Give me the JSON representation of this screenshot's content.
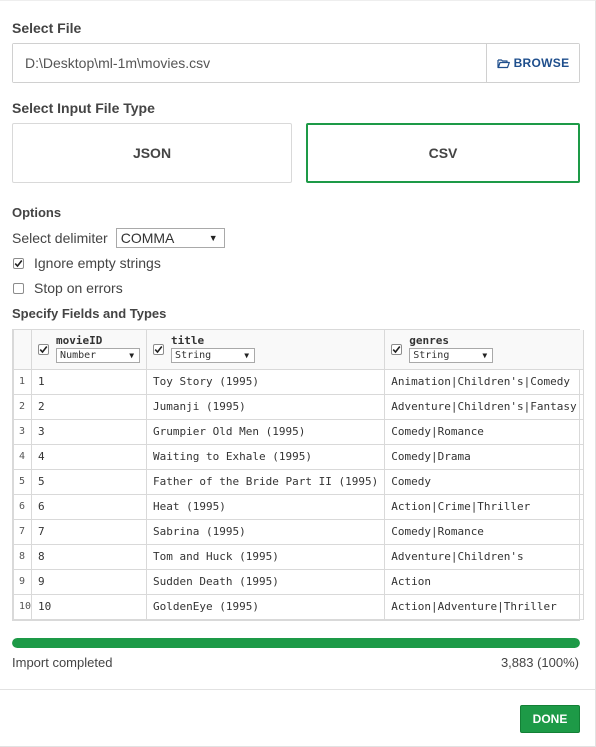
{
  "select_file": {
    "title": "Select File",
    "path": "D:\\Desktop\\ml-1m\\movies.csv",
    "browse_label": "BROWSE"
  },
  "input_type": {
    "title": "Select Input File Type",
    "json_label": "JSON",
    "csv_label": "CSV",
    "selected": "CSV"
  },
  "options": {
    "title": "Options",
    "delimiter_label": "Select delimiter",
    "delimiter_value": "COMMA",
    "ignore_empty_label": "Ignore empty strings",
    "ignore_empty_checked": true,
    "stop_on_errors_label": "Stop on errors",
    "stop_on_errors_checked": false
  },
  "fields": {
    "title": "Specify Fields and Types",
    "columns": [
      {
        "name": "movieID",
        "type": "Number",
        "checked": true
      },
      {
        "name": "title",
        "type": "String",
        "checked": true
      },
      {
        "name": "genres",
        "type": "String",
        "checked": true
      }
    ],
    "rows": [
      {
        "n": "1",
        "cells": [
          "1",
          "Toy Story (1995)",
          "Animation|Children's|Comedy"
        ]
      },
      {
        "n": "2",
        "cells": [
          "2",
          "Jumanji (1995)",
          "Adventure|Children's|Fantasy"
        ]
      },
      {
        "n": "3",
        "cells": [
          "3",
          "Grumpier Old Men (1995)",
          "Comedy|Romance"
        ]
      },
      {
        "n": "4",
        "cells": [
          "4",
          "Waiting to Exhale (1995)",
          "Comedy|Drama"
        ]
      },
      {
        "n": "5",
        "cells": [
          "5",
          "Father of the Bride Part II (1995)",
          "Comedy"
        ]
      },
      {
        "n": "6",
        "cells": [
          "6",
          "Heat (1995)",
          "Action|Crime|Thriller"
        ]
      },
      {
        "n": "7",
        "cells": [
          "7",
          "Sabrina (1995)",
          "Comedy|Romance"
        ]
      },
      {
        "n": "8",
        "cells": [
          "8",
          "Tom and Huck (1995)",
          "Adventure|Children's"
        ]
      },
      {
        "n": "9",
        "cells": [
          "9",
          "Sudden Death (1995)",
          "Action"
        ]
      },
      {
        "n": "10",
        "cells": [
          "10",
          "GoldenEye (1995)",
          "Action|Adventure|Thriller"
        ]
      }
    ]
  },
  "progress": {
    "fraction": 1.0,
    "status": "Import completed",
    "count": "3,883 (100%)"
  },
  "footer": {
    "done_label": "DONE"
  },
  "colors": {
    "accent_green": "#1d9a47",
    "link_blue": "#1e4e8c"
  },
  "icons": {
    "browse": "folder-open-icon",
    "checkbox": "checkmark-icon",
    "dropdown": "caret-down-icon"
  }
}
